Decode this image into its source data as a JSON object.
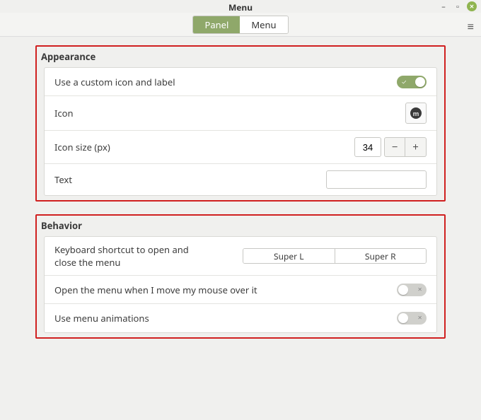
{
  "window": {
    "title": "Menu"
  },
  "tabs": {
    "panel": "Panel",
    "menu": "Menu",
    "active": "Panel"
  },
  "appearance": {
    "title": "Appearance",
    "custom_icon_label": "Use a custom icon and label",
    "custom_icon_on": true,
    "icon_label": "Icon",
    "icon_size_label": "Icon size (px)",
    "icon_size_value": "34",
    "text_label": "Text",
    "text_value": ""
  },
  "behavior": {
    "title": "Behavior",
    "shortcut_label": "Keyboard shortcut to open and close the menu",
    "shortcut_a": "Super L",
    "shortcut_b": "Super R",
    "hover_label": "Open the menu when I move my mouse over it",
    "hover_on": false,
    "anim_label": "Use menu animations",
    "anim_on": false
  }
}
